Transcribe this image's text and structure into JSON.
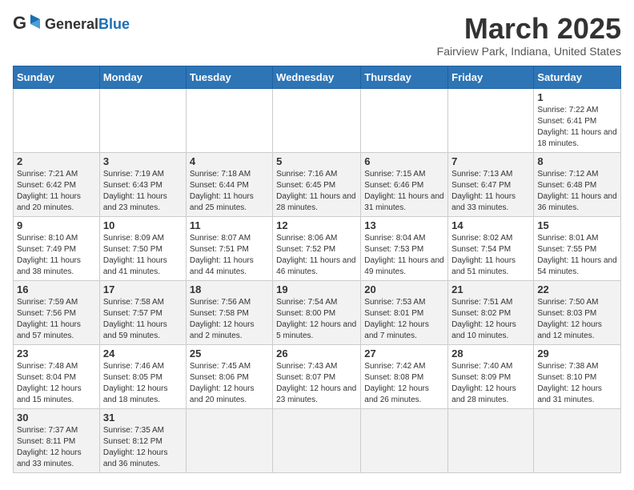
{
  "header": {
    "logo_general": "General",
    "logo_blue": "Blue",
    "month_title": "March 2025",
    "location": "Fairview Park, Indiana, United States"
  },
  "weekdays": [
    "Sunday",
    "Monday",
    "Tuesday",
    "Wednesday",
    "Thursday",
    "Friday",
    "Saturday"
  ],
  "weeks": [
    [
      {
        "day": "",
        "info": ""
      },
      {
        "day": "",
        "info": ""
      },
      {
        "day": "",
        "info": ""
      },
      {
        "day": "",
        "info": ""
      },
      {
        "day": "",
        "info": ""
      },
      {
        "day": "",
        "info": ""
      },
      {
        "day": "1",
        "info": "Sunrise: 7:22 AM\nSunset: 6:41 PM\nDaylight: 11 hours\nand 18 minutes."
      }
    ],
    [
      {
        "day": "2",
        "info": "Sunrise: 7:21 AM\nSunset: 6:42 PM\nDaylight: 11 hours\nand 20 minutes."
      },
      {
        "day": "3",
        "info": "Sunrise: 7:19 AM\nSunset: 6:43 PM\nDaylight: 11 hours\nand 23 minutes."
      },
      {
        "day": "4",
        "info": "Sunrise: 7:18 AM\nSunset: 6:44 PM\nDaylight: 11 hours\nand 25 minutes."
      },
      {
        "day": "5",
        "info": "Sunrise: 7:16 AM\nSunset: 6:45 PM\nDaylight: 11 hours\nand 28 minutes."
      },
      {
        "day": "6",
        "info": "Sunrise: 7:15 AM\nSunset: 6:46 PM\nDaylight: 11 hours\nand 31 minutes."
      },
      {
        "day": "7",
        "info": "Sunrise: 7:13 AM\nSunset: 6:47 PM\nDaylight: 11 hours\nand 33 minutes."
      },
      {
        "day": "8",
        "info": "Sunrise: 7:12 AM\nSunset: 6:48 PM\nDaylight: 11 hours\nand 36 minutes."
      }
    ],
    [
      {
        "day": "9",
        "info": "Sunrise: 8:10 AM\nSunset: 7:49 PM\nDaylight: 11 hours\nand 38 minutes."
      },
      {
        "day": "10",
        "info": "Sunrise: 8:09 AM\nSunset: 7:50 PM\nDaylight: 11 hours\nand 41 minutes."
      },
      {
        "day": "11",
        "info": "Sunrise: 8:07 AM\nSunset: 7:51 PM\nDaylight: 11 hours\nand 44 minutes."
      },
      {
        "day": "12",
        "info": "Sunrise: 8:06 AM\nSunset: 7:52 PM\nDaylight: 11 hours\nand 46 minutes."
      },
      {
        "day": "13",
        "info": "Sunrise: 8:04 AM\nSunset: 7:53 PM\nDaylight: 11 hours\nand 49 minutes."
      },
      {
        "day": "14",
        "info": "Sunrise: 8:02 AM\nSunset: 7:54 PM\nDaylight: 11 hours\nand 51 minutes."
      },
      {
        "day": "15",
        "info": "Sunrise: 8:01 AM\nSunset: 7:55 PM\nDaylight: 11 hours\nand 54 minutes."
      }
    ],
    [
      {
        "day": "16",
        "info": "Sunrise: 7:59 AM\nSunset: 7:56 PM\nDaylight: 11 hours\nand 57 minutes."
      },
      {
        "day": "17",
        "info": "Sunrise: 7:58 AM\nSunset: 7:57 PM\nDaylight: 11 hours\nand 59 minutes."
      },
      {
        "day": "18",
        "info": "Sunrise: 7:56 AM\nSunset: 7:58 PM\nDaylight: 12 hours\nand 2 minutes."
      },
      {
        "day": "19",
        "info": "Sunrise: 7:54 AM\nSunset: 8:00 PM\nDaylight: 12 hours\nand 5 minutes."
      },
      {
        "day": "20",
        "info": "Sunrise: 7:53 AM\nSunset: 8:01 PM\nDaylight: 12 hours\nand 7 minutes."
      },
      {
        "day": "21",
        "info": "Sunrise: 7:51 AM\nSunset: 8:02 PM\nDaylight: 12 hours\nand 10 minutes."
      },
      {
        "day": "22",
        "info": "Sunrise: 7:50 AM\nSunset: 8:03 PM\nDaylight: 12 hours\nand 12 minutes."
      }
    ],
    [
      {
        "day": "23",
        "info": "Sunrise: 7:48 AM\nSunset: 8:04 PM\nDaylight: 12 hours\nand 15 minutes."
      },
      {
        "day": "24",
        "info": "Sunrise: 7:46 AM\nSunset: 8:05 PM\nDaylight: 12 hours\nand 18 minutes."
      },
      {
        "day": "25",
        "info": "Sunrise: 7:45 AM\nSunset: 8:06 PM\nDaylight: 12 hours\nand 20 minutes."
      },
      {
        "day": "26",
        "info": "Sunrise: 7:43 AM\nSunset: 8:07 PM\nDaylight: 12 hours\nand 23 minutes."
      },
      {
        "day": "27",
        "info": "Sunrise: 7:42 AM\nSunset: 8:08 PM\nDaylight: 12 hours\nand 26 minutes."
      },
      {
        "day": "28",
        "info": "Sunrise: 7:40 AM\nSunset: 8:09 PM\nDaylight: 12 hours\nand 28 minutes."
      },
      {
        "day": "29",
        "info": "Sunrise: 7:38 AM\nSunset: 8:10 PM\nDaylight: 12 hours\nand 31 minutes."
      }
    ],
    [
      {
        "day": "30",
        "info": "Sunrise: 7:37 AM\nSunset: 8:11 PM\nDaylight: 12 hours\nand 33 minutes."
      },
      {
        "day": "31",
        "info": "Sunrise: 7:35 AM\nSunset: 8:12 PM\nDaylight: 12 hours\nand 36 minutes."
      },
      {
        "day": "",
        "info": ""
      },
      {
        "day": "",
        "info": ""
      },
      {
        "day": "",
        "info": ""
      },
      {
        "day": "",
        "info": ""
      },
      {
        "day": "",
        "info": ""
      }
    ]
  ]
}
